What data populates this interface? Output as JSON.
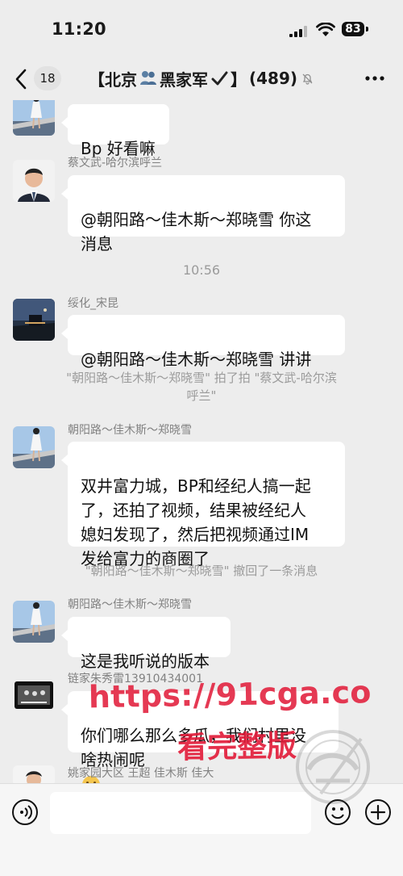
{
  "status": {
    "time": "11:20",
    "battery": "83"
  },
  "header": {
    "unread_count": "18",
    "title": "【北京",
    "title_suffix": "黑家军",
    "title_close": "】",
    "member_count": "(489)"
  },
  "messages": [
    {
      "type": "message",
      "sender": "",
      "text": "Bp 好看嘛"
    },
    {
      "type": "message",
      "sender": "蔡文武-哈尔滨呼兰",
      "text": "@朝阳路～佳木斯～郑晓雪 你这\n消息"
    },
    {
      "type": "timestamp",
      "text": "10:56"
    },
    {
      "type": "message",
      "sender": "绥化_宋昆",
      "text": "@朝阳路～佳木斯～郑晓雪 讲讲"
    },
    {
      "type": "system",
      "text": "\"朝阳路～佳木斯～郑晓雪\" 拍了拍 \"蔡文武-哈尔滨\n呼兰\""
    },
    {
      "type": "message",
      "sender": "朝阳路～佳木斯～郑晓雪",
      "text": "双井富力城，BP和经纪人搞一起\n了，还拍了视频，结果被经纪人\n媳妇发现了，然后把视频通过IM\n发给富力的商圈了"
    },
    {
      "type": "system",
      "text": "\"朝阳路～佳木斯～郑晓雪\" 撤回了一条消息"
    },
    {
      "type": "message",
      "sender": "朝阳路～佳木斯～郑晓雪",
      "text": "这是我听说的版本"
    },
    {
      "type": "message",
      "sender": "链家朱秀雷13910434001",
      "text": "你们哪么那么多瓜，我们村里没\n啥热闹呢"
    },
    {
      "type": "message",
      "sender": "姚家园大区 王超 佳木斯 佳大",
      "text": ""
    }
  ],
  "watermark": {
    "url": "https://91cga.co",
    "subtitle": "看完整版"
  },
  "icons": {
    "back": "chevron-left-icon",
    "people": "people-icon",
    "check": "checkmark-icon",
    "mute": "muted-bell-icon",
    "more": "more-horizontal-icon",
    "voice": "voice-input-icon",
    "emoji": "emoji-icon",
    "plus": "plus-icon"
  },
  "colors": {
    "background": "#ededed",
    "bubble": "#ffffff",
    "watermark": "#e11937",
    "timestamp": "#9b9b9b"
  }
}
